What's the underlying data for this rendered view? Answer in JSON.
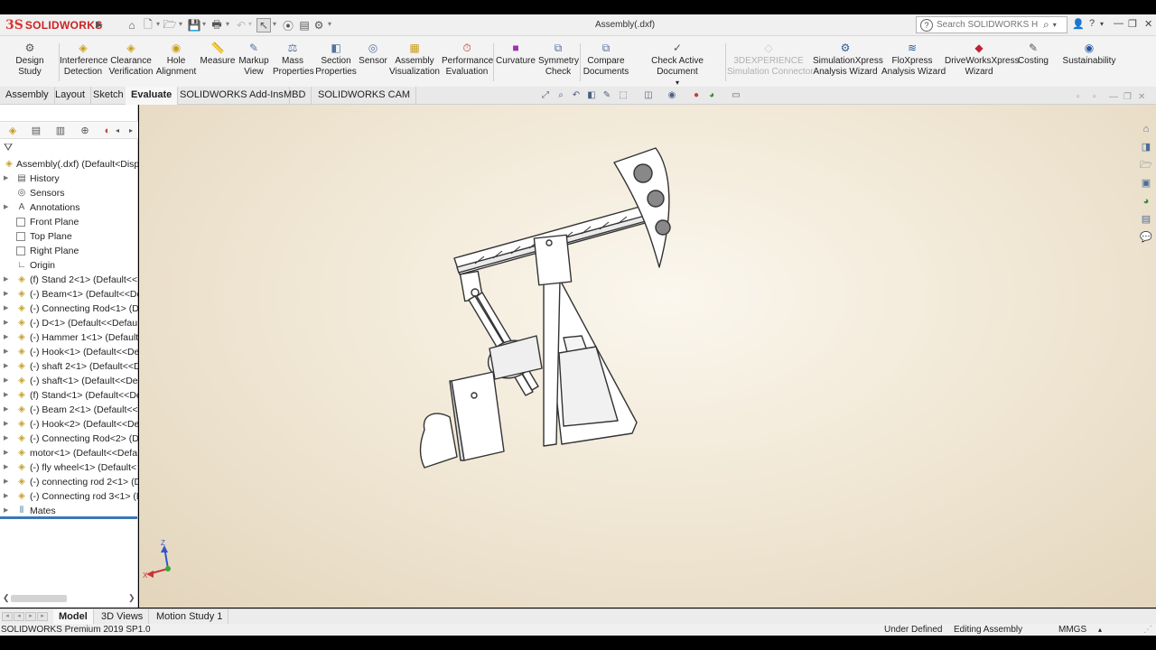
{
  "app": {
    "brand": "SOLIDWORKS",
    "window_title": "Assembly(.dxf)",
    "help_search_placeholder": "Search SOLIDWORKS Help"
  },
  "ribbon": {
    "buttons": [
      {
        "name": "design-study",
        "label": "Design Study",
        "icon": "design-study-icon"
      },
      {
        "name": "interference-detection",
        "label": "Interference\nDetection",
        "icon": "interference-icon"
      },
      {
        "name": "clearance-verification",
        "label": "Clearance\nVerification",
        "icon": "clearance-icon"
      },
      {
        "name": "hole-alignment",
        "label": "Hole\nAlignment",
        "icon": "hole-icon"
      },
      {
        "name": "measure",
        "label": "Measure",
        "icon": "ruler-icon"
      },
      {
        "name": "markup-view",
        "label": "Markup\nView",
        "icon": "pen-icon"
      },
      {
        "name": "mass-properties",
        "label": "Mass\nProperties",
        "icon": "scale-icon"
      },
      {
        "name": "section-properties",
        "label": "Section\nProperties",
        "icon": "section-icon"
      },
      {
        "name": "sensor",
        "label": "Sensor",
        "icon": "sensor-icon"
      },
      {
        "name": "assembly-visualization",
        "label": "Assembly\nVisualization",
        "icon": "assembly-viz-icon"
      },
      {
        "name": "performance-evaluation",
        "label": "Performance\nEvaluation",
        "icon": "performance-icon"
      },
      {
        "name": "curvature",
        "label": "Curvature",
        "icon": "curvature-icon"
      },
      {
        "name": "symmetry-check",
        "label": "Symmetry\nCheck",
        "icon": "symmetry-icon"
      },
      {
        "name": "compare-documents",
        "label": "Compare\nDocuments",
        "icon": "compare-icon"
      },
      {
        "name": "check-active-document",
        "label": "Check Active Document",
        "icon": "check-icon"
      },
      {
        "name": "3dexperience-connector",
        "label": "3DEXPERIENCE\nSimulation Connector",
        "icon": "3dx-icon",
        "disabled": true
      },
      {
        "name": "simulationxpress",
        "label": "SimulationXpress\nAnalysis Wizard",
        "icon": "simxpress-icon"
      },
      {
        "name": "floxpress",
        "label": "FloXpress\nAnalysis Wizard",
        "icon": "floxpress-icon"
      },
      {
        "name": "driveworksxpress",
        "label": "DriveWorksXpress\nWizard",
        "icon": "driveworks-icon"
      },
      {
        "name": "costing",
        "label": "Costing",
        "icon": "costing-icon"
      },
      {
        "name": "sustainability",
        "label": "Sustainability",
        "icon": "sustainability-icon"
      }
    ]
  },
  "tabs": [
    "Assembly",
    "Layout",
    "Sketch",
    "Evaluate",
    "SOLIDWORKS Add-Ins",
    "MBD",
    "SOLIDWORKS CAM"
  ],
  "active_tab": "Evaluate",
  "feature_tree": {
    "root": "Assembly(.dxf)  (Default<Displ",
    "items": [
      {
        "label": "History",
        "type": "history"
      },
      {
        "label": "Sensors",
        "type": "sensor"
      },
      {
        "label": "Annotations",
        "type": "annotation"
      },
      {
        "label": "Front Plane",
        "type": "plane"
      },
      {
        "label": "Top Plane",
        "type": "plane"
      },
      {
        "label": "Right Plane",
        "type": "plane"
      },
      {
        "label": "Origin",
        "type": "origin"
      },
      {
        "label": "(f) Stand 2<1> (Default<<I",
        "type": "component"
      },
      {
        "label": "(-) Beam<1> (Default<<De",
        "type": "component"
      },
      {
        "label": "(-) Connecting Rod<1> (De",
        "type": "component"
      },
      {
        "label": "(-) D<1> (Default<<Defau",
        "type": "component"
      },
      {
        "label": "(-) Hammer 1<1> (Default",
        "type": "component"
      },
      {
        "label": "(-) Hook<1> (Default<<De",
        "type": "component"
      },
      {
        "label": "(-) shaft 2<1> (Default<<D",
        "type": "component"
      },
      {
        "label": "(-) shaft<1> (Default<<De",
        "type": "component"
      },
      {
        "label": "(f) Stand<1> (Default<<De",
        "type": "component"
      },
      {
        "label": "(-) Beam 2<1> (Default<<I",
        "type": "component"
      },
      {
        "label": "(-) Hook<2> (Default<<De",
        "type": "component"
      },
      {
        "label": "(-) Connecting Rod<2> (De",
        "type": "component"
      },
      {
        "label": "motor<1> (Default<<Defa",
        "type": "component"
      },
      {
        "label": "(-) fly wheel<1> (Default<",
        "type": "component"
      },
      {
        "label": "(-) connecting rod 2<1> (D",
        "type": "component"
      },
      {
        "label": "(-) Connecting rod 3<1> (D",
        "type": "component"
      },
      {
        "label": "Mates",
        "type": "mates"
      }
    ]
  },
  "bottom_tabs": [
    "Model",
    "3D Views",
    "Motion Study 1"
  ],
  "active_bottom_tab": "Model",
  "status": {
    "product": "SOLIDWORKS Premium 2019 SP1.0",
    "definition": "Under Defined",
    "mode": "Editing Assembly",
    "units": "MMGS"
  },
  "triad": {
    "z": "Z",
    "x": "X"
  }
}
